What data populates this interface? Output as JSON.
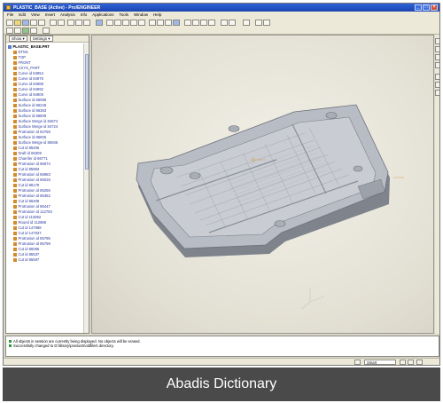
{
  "window": {
    "title": "PLASTIC_BASE (Active) - Pro/ENGINEER",
    "controls": {
      "minimize": "_",
      "maximize": "□",
      "close": "×"
    }
  },
  "menu": [
    "File",
    "Edit",
    "View",
    "Insert",
    "Analysis",
    "Info",
    "Applications",
    "Tools",
    "Window",
    "Help"
  ],
  "tree_panel": {
    "show_label": "Show ▾",
    "settings_label": "Settings ▾",
    "items": [
      "PLASTIC_BASE.PRT",
      "DTM1",
      "TOP",
      "FRONT",
      "CSYS_PART",
      "Curve id 84954",
      "Curve id 84976",
      "Curve id 84988",
      "Curve id 84992",
      "Curve id 84906",
      "Surface id 86098",
      "Surface id 86249",
      "Surface id 86383",
      "Surface id 86609",
      "Surface Merge id 84674",
      "Surface Merge id 84724",
      "Protrusion id 84758",
      "Surface id 85605",
      "Surface Merge id 85946",
      "Cut id 85406",
      "Draft id 86309",
      "Chamfer id 86771",
      "Protrusion id 85874",
      "Cut id 85963",
      "Protrusion id 85983",
      "Protrusion id 86028",
      "Cut id 86179",
      "Protrusion id 86255",
      "Protrusion id 86352",
      "Cut id 86408",
      "Protrusion id 86447",
      "Protrusion id 112793",
      "Cut id 112852",
      "Round id 112886",
      "Cut id 147988",
      "Cut id 147637",
      "Protrusion id 85795",
      "Protrusion id 85799",
      "Cut id 86086",
      "Cut id 85537",
      "Cut id 85597"
    ]
  },
  "messages": [
    "All objects in session are currently being displayed. No objects will be erased.",
    "Successfully changed to D:\\library\\products\\oldfiles\\ directory."
  ],
  "status": {
    "filter": "Smart"
  },
  "caption": "Abadis Dictionary",
  "colors": {
    "titlebar": "#2350c4",
    "part_body": "#b8bcc4",
    "part_shadow": "#7e838c",
    "background": "#e8e6dc",
    "caption_bg": "#4a4a4a"
  }
}
